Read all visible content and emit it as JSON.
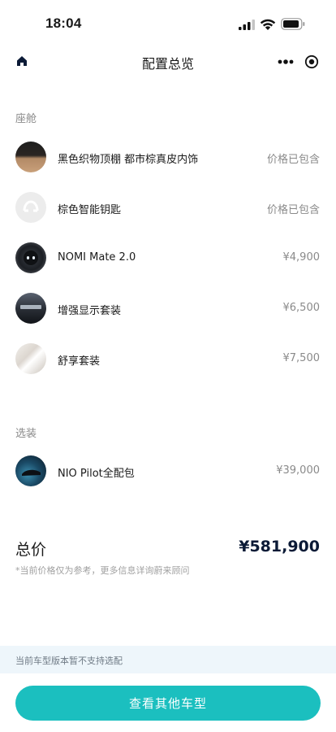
{
  "status_bar": {
    "time": "18:04",
    "icons": [
      "signal-icon",
      "wifi-icon",
      "battery-icon"
    ]
  },
  "nav": {
    "title": "配置总览",
    "left_icon": "home-icon",
    "capsule_icons": [
      "more-icon",
      "target-icon"
    ]
  },
  "cabin": {
    "section_title": "座舱",
    "items": [
      {
        "name": "黑色织物顶棚 都市棕真皮内饰",
        "price": "价格已包含",
        "thumb": "interior-trim-thumb"
      },
      {
        "name": "棕色智能钥匙",
        "price": "价格已包含",
        "thumb": "smart-key-thumb"
      },
      {
        "name": "NOMI Mate 2.0",
        "price": "¥4,900",
        "thumb": "nomi-thumb"
      },
      {
        "name": "增强显示套装",
        "price": "¥6,500",
        "thumb": "display-thumb"
      },
      {
        "name": "舒享套装",
        "price": "¥7,500",
        "thumb": "comfort-thumb"
      }
    ]
  },
  "options": {
    "section_title": "选装",
    "items": [
      {
        "name": "NIO Pilot全配包",
        "price": "¥39,000",
        "thumb": "pilot-thumb"
      }
    ]
  },
  "total": {
    "label": "总价",
    "value": "¥581,900",
    "note": "*当前价格仅为参考，更多信息详询蔚来顾问"
  },
  "notice": {
    "text": "当前车型版本暂不支持选配"
  },
  "cta": {
    "label": "查看其他车型"
  },
  "colors": {
    "accent": "#1bbfbf",
    "price_total": "#0b1a36",
    "muted": "#8a8a8a",
    "notice_bg": "#eef6fb"
  }
}
